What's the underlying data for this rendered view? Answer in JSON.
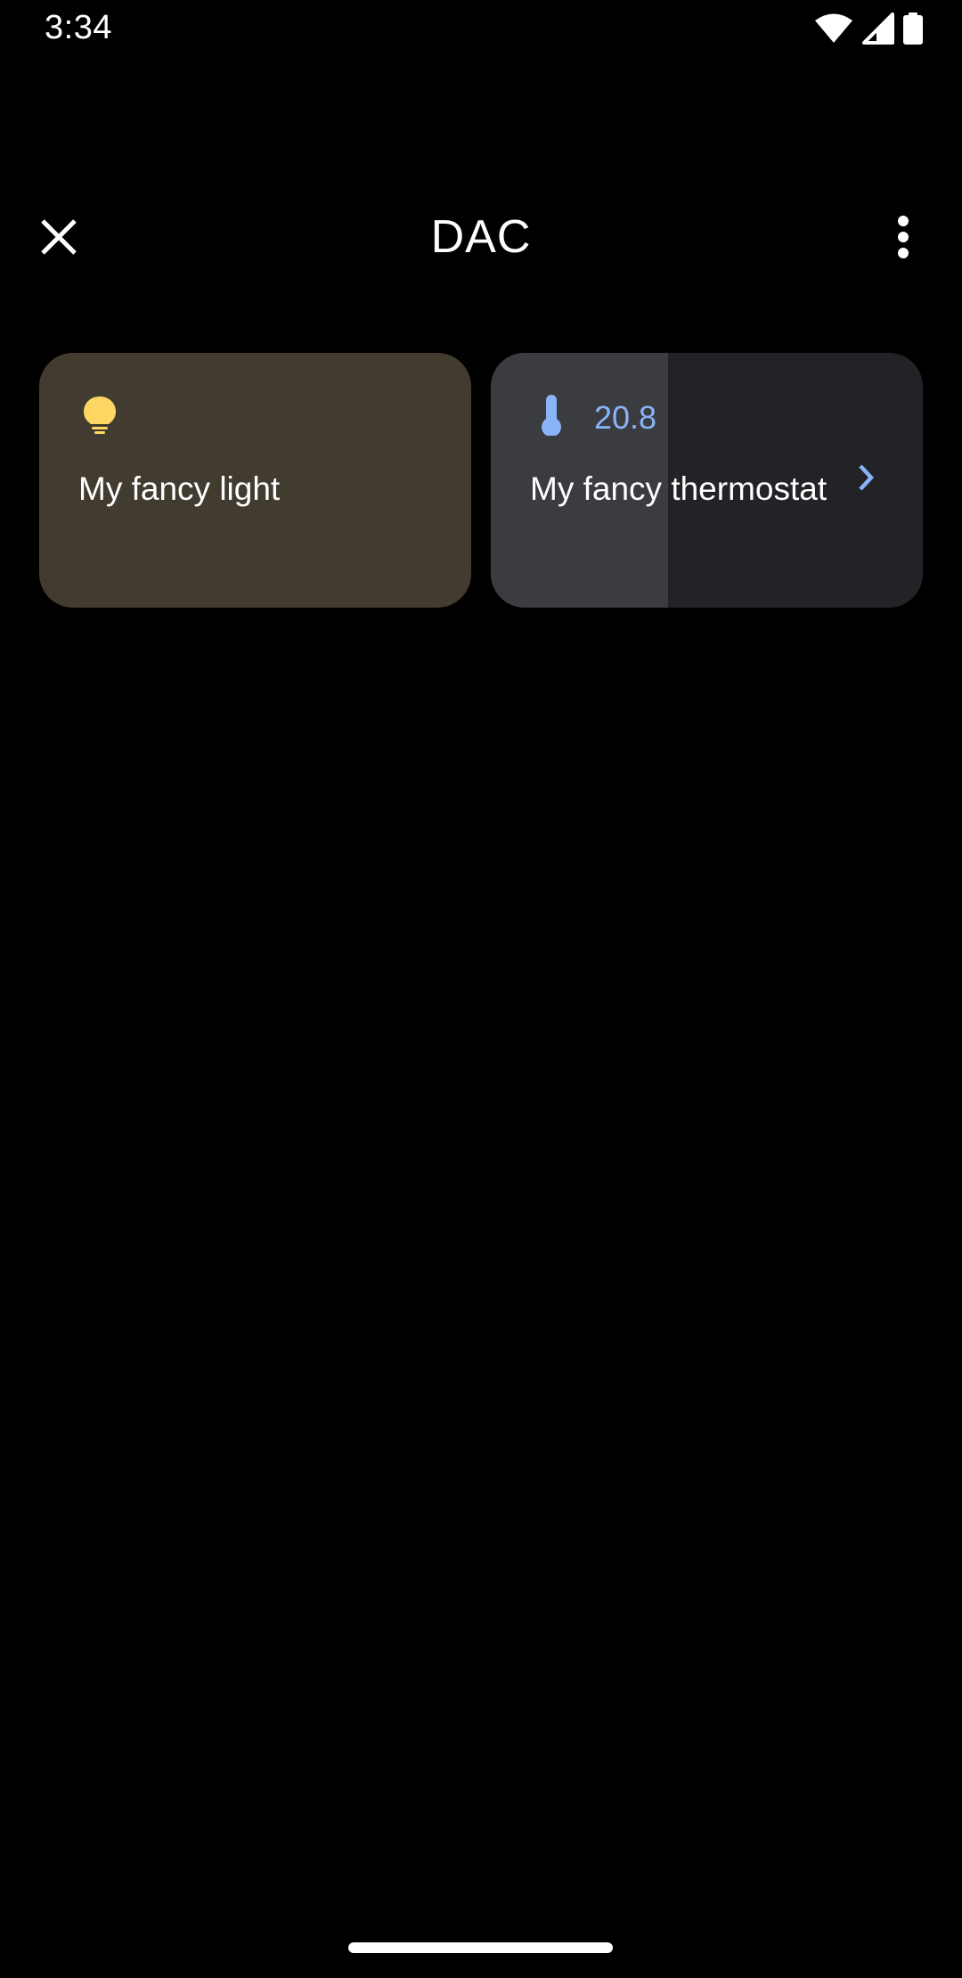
{
  "status_bar": {
    "time": "3:34",
    "icons": [
      "wifi-icon",
      "cellular-signal-icon",
      "battery-icon"
    ]
  },
  "app_bar": {
    "title": "DAC",
    "close_icon": "close-icon",
    "overflow_icon": "more-vert-icon"
  },
  "controls": [
    {
      "title": "My fancy light",
      "icon": "lightbulb-icon",
      "status": "",
      "background": "#423b2f",
      "icon_color": "#fdd663"
    },
    {
      "title": "My fancy thermostat",
      "icon": "thermometer-icon",
      "status": "20.8",
      "background": "#222327",
      "fill_color": "#3b3c40",
      "icon_color": "#8ab4f8",
      "fill_fraction": 0.41
    }
  ],
  "colors": {
    "background": "#000000",
    "accent_blue": "#8ab4f8",
    "accent_yellow": "#fdd663",
    "text": "#ffffff"
  }
}
